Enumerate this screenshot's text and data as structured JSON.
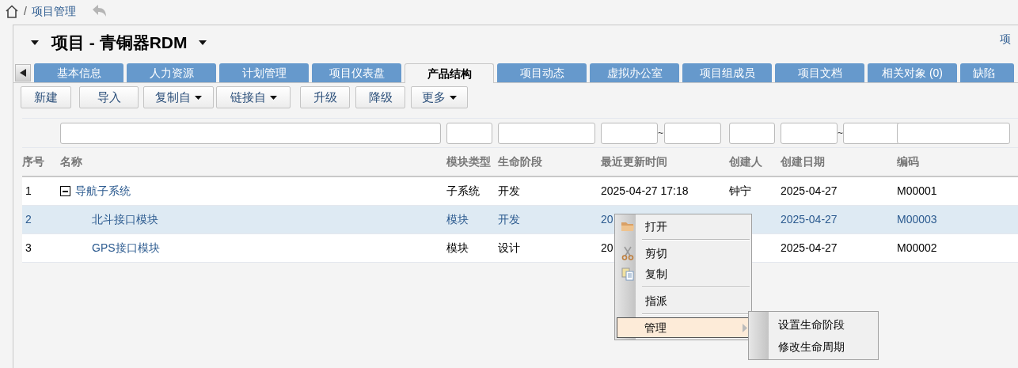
{
  "breadcrumb": {
    "items": [
      "/",
      "项目管理"
    ]
  },
  "title": "项目 - 青铜器RDM",
  "top_right_link": "项",
  "tabs": [
    {
      "label": "基本信息",
      "selected": false
    },
    {
      "label": "人力资源",
      "selected": false
    },
    {
      "label": "计划管理",
      "selected": false
    },
    {
      "label": "项目仪表盘",
      "selected": false
    },
    {
      "label": "产品结构",
      "selected": true
    },
    {
      "label": "项目动态",
      "selected": false
    },
    {
      "label": "虚拟办公室",
      "selected": false
    },
    {
      "label": "项目组成员",
      "selected": false
    },
    {
      "label": "项目文档",
      "selected": false
    },
    {
      "label": "相关对象 (0)",
      "selected": false
    },
    {
      "label": "缺陷",
      "selected": false
    }
  ],
  "toolbar": [
    {
      "label": "新建",
      "kind": "plain"
    },
    {
      "label": "导入",
      "kind": "plain"
    },
    {
      "label": "复制自",
      "kind": "dropdown"
    },
    {
      "label": "链接自",
      "kind": "dropdown"
    },
    {
      "label": "升级",
      "kind": "plain"
    },
    {
      "label": "降级",
      "kind": "plain"
    },
    {
      "label": "更多",
      "kind": "dropdown"
    }
  ],
  "filters": [
    {
      "kind": "none"
    },
    {
      "kind": "text"
    },
    {
      "kind": "text"
    },
    {
      "kind": "text"
    },
    {
      "kind": "range",
      "separator": "~"
    },
    {
      "kind": "text"
    },
    {
      "kind": "range",
      "separator": "~"
    },
    {
      "kind": "text"
    }
  ],
  "table": {
    "columns": [
      "序号",
      "名称",
      "模块类型",
      "生命阶段",
      "最近更新时间",
      "创建人",
      "创建日期",
      "编码"
    ],
    "rows": [
      {
        "index": "1",
        "name": "导航子系统",
        "type": "子系统",
        "stage": "开发",
        "updated": "2025-04-27 17:18",
        "creator": "钟宁",
        "created": "2025-04-27",
        "code": "M00001",
        "selected": false,
        "expanded": true,
        "children": [
          {
            "index": "2",
            "name": "北斗接口模块",
            "type": "模块",
            "stage": "开发",
            "updated": "20",
            "created": "2025-04-27",
            "code": "M00003",
            "selected": true
          },
          {
            "index": "3",
            "name": "GPS接口模块",
            "type": "模块",
            "stage": "设计",
            "updated": "20",
            "created": "2025-04-27",
            "code": "M00002",
            "selected": false
          }
        ]
      }
    ]
  },
  "context_menu": {
    "items": [
      {
        "label": "打开",
        "separator_before": false,
        "highlighted": false,
        "has_submenu": false
      },
      {
        "label": "剪切",
        "separator_before": true,
        "highlighted": false,
        "has_submenu": false
      },
      {
        "label": "复制",
        "separator_before": false,
        "highlighted": false,
        "has_submenu": false
      },
      {
        "label": "指派",
        "separator_before": true,
        "highlighted": false,
        "has_submenu": false
      },
      {
        "label": "管理",
        "separator_before": true,
        "highlighted": true,
        "has_submenu": true
      }
    ],
    "submenu": [
      "设置生命阶段",
      "修改生命周期"
    ]
  }
}
